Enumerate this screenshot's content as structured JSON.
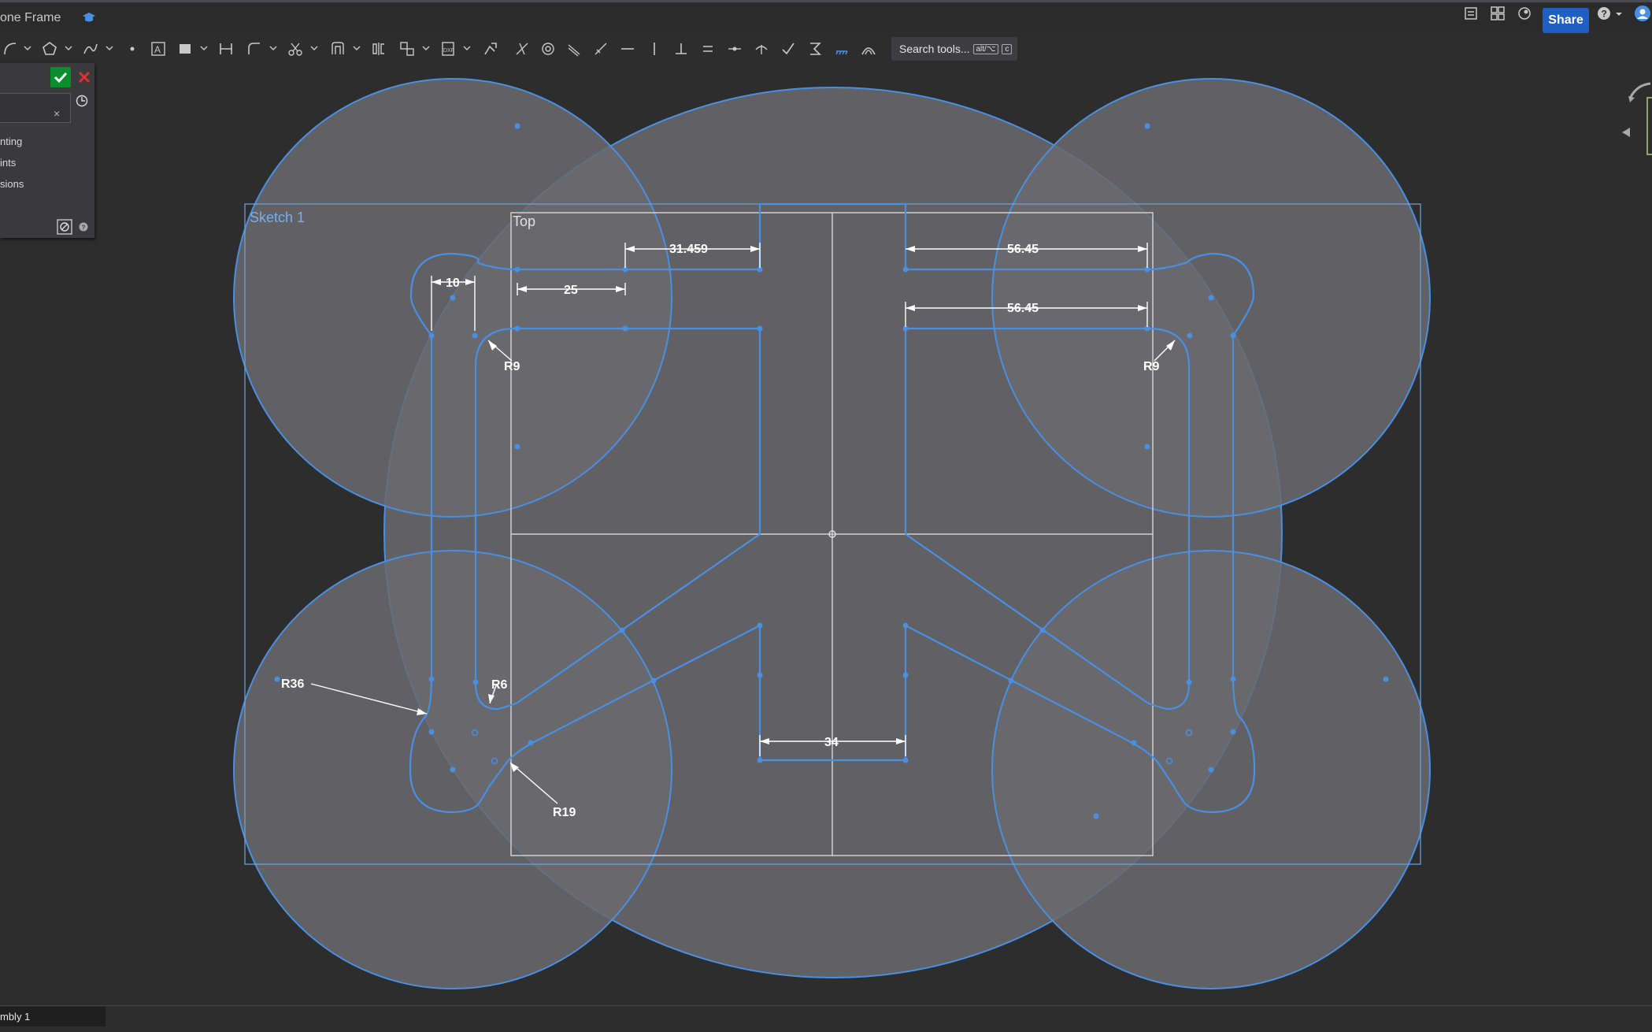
{
  "app": {
    "doc_title": "one Frame",
    "share_label": "Share",
    "search_label": "Search tools...",
    "search_shortcut_1": "alt/⌥",
    "search_shortcut_2": "c"
  },
  "panel": {
    "options": [
      "nting",
      "ints",
      "sions"
    ],
    "clear_symbol": "×"
  },
  "sketch": {
    "sketch_label": "Sketch 1",
    "plane_label": "Top",
    "dimensions": {
      "d_31": "31.459",
      "d_56a": "56.45",
      "d_56b": "56.45",
      "d_25": "25",
      "d_10": "10",
      "d_34": "34",
      "r9_left": "R9",
      "r9_right": "R9",
      "r36": "R36",
      "r6": "R6",
      "r19": "R19"
    }
  },
  "bottom": {
    "tab_label": "mbly 1"
  },
  "colors": {
    "sketch_blue": "#4a90e2",
    "fill_gray": "#6a6a6e",
    "accent": "#1f5fc4",
    "ok_green": "#0a8e2d",
    "cancel_red": "#e03030"
  }
}
